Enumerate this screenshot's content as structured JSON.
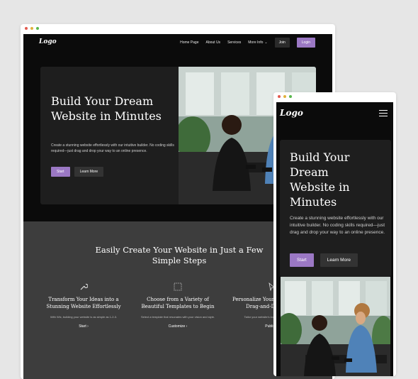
{
  "site": {
    "logo": "Logo",
    "nav": {
      "items": [
        "Home Page",
        "About Us",
        "Services",
        "More Info"
      ],
      "join_label": "Join",
      "login_label": "Login"
    },
    "hero": {
      "title": "Build Your Dream Website in Minutes",
      "description": "Create a stunning website effortlessly with our intuitive builder. No coding skills required—just drag and drop your way to an online presence.",
      "start_label": "Start",
      "learn_more_label": "Learn More"
    },
    "steps": {
      "title": "Easily Create Your Website in Just a Few Simple Steps",
      "items": [
        {
          "title": "Transform Your Ideas into a Stunning Website Effortlessly",
          "description": "With Wix, building your website is as simple as 1-2-3.",
          "link": "Start"
        },
        {
          "title": "Choose from a Variety of Beautiful Templates to Begin",
          "description": "Select a template that resonates with your vision and style.",
          "link": "Customize"
        },
        {
          "title": "Personalize Your Site with Easy Drag-and-Drop Tools",
          "description": "Tailor your website's look and feel with ease.",
          "link": "Publish"
        }
      ]
    }
  },
  "colors": {
    "accent": "#9b78c4",
    "page_bg": "#0b0b0b",
    "card_bg": "#1e1e1e",
    "steps_bg": "#3d3d3d"
  },
  "icons": {
    "menu": "hamburger-icon",
    "step1": "wrench-icon",
    "step2": "dashed-square-icon",
    "step3": "cursor-icon"
  }
}
